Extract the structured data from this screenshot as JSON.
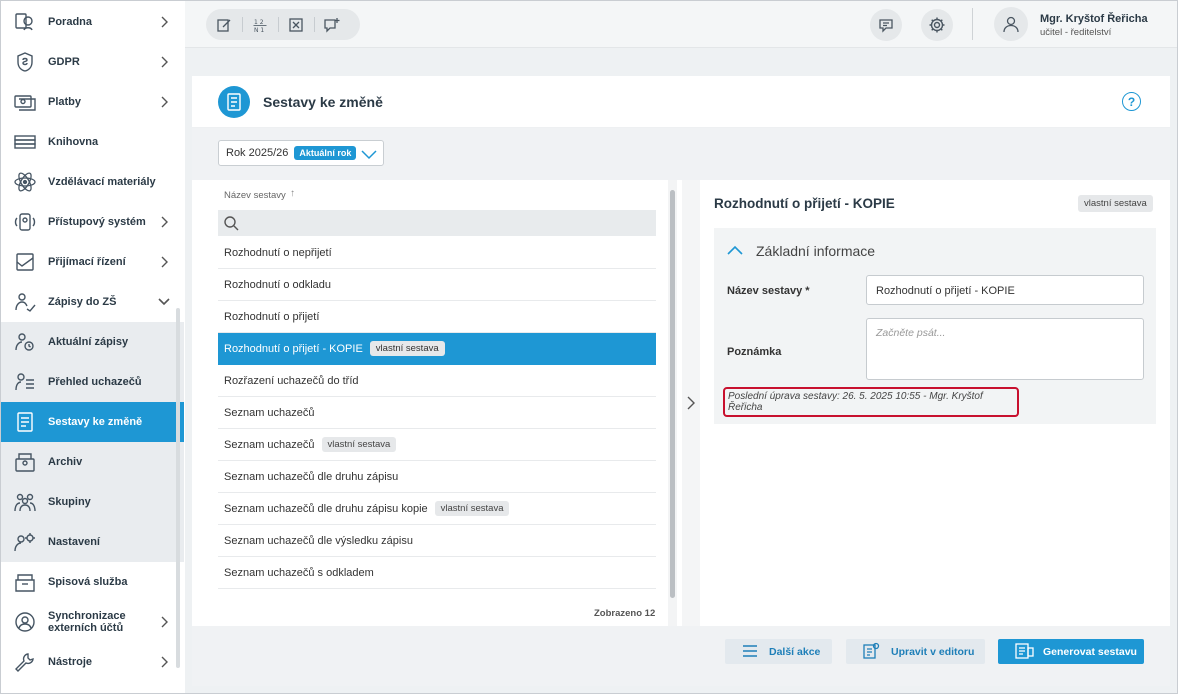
{
  "sidebar": {
    "items": [
      {
        "label": "Poradna",
        "icon": "consult-icon",
        "chevron": "right"
      },
      {
        "label": "GDPR",
        "icon": "gdpr-shield-icon",
        "chevron": "right"
      },
      {
        "label": "Platby",
        "icon": "payments-icon",
        "chevron": "right"
      },
      {
        "label": "Knihovna",
        "icon": "library-icon",
        "chevron": ""
      },
      {
        "label": "Vzdělávací materiály",
        "icon": "atom-icon",
        "chevron": ""
      },
      {
        "label": "Přístupový systém",
        "icon": "access-icon",
        "chevron": "right"
      },
      {
        "label": "Přijímací řízení",
        "icon": "admission-icon",
        "chevron": "right"
      },
      {
        "label": "Zápisy do ZŠ",
        "icon": "enrollment-icon",
        "chevron": "down"
      },
      {
        "label": "Aktuální zápisy",
        "icon": "current-enrollment-icon",
        "chevron": ""
      },
      {
        "label": "Přehled uchazečů",
        "icon": "applicants-icon",
        "chevron": ""
      },
      {
        "label": "Sestavy ke změně",
        "icon": "report-icon",
        "chevron": ""
      },
      {
        "label": "Archiv",
        "icon": "archive-icon",
        "chevron": ""
      },
      {
        "label": "Skupiny",
        "icon": "groups-icon",
        "chevron": ""
      },
      {
        "label": "Nastavení",
        "icon": "settings-user-icon",
        "chevron": ""
      },
      {
        "label": "Spisová služba",
        "icon": "filing-icon",
        "chevron": ""
      },
      {
        "label": "Synchronizace externích účtů",
        "icon": "sync-accounts-icon",
        "chevron": "right"
      },
      {
        "label": "Nástroje",
        "icon": "wrench-icon",
        "chevron": "right"
      }
    ]
  },
  "topbar": {
    "user_name": "Mgr. Kryštof Řeřicha",
    "user_role": "učitel - ředitelství",
    "tools": [
      "edit-icon",
      "numbering-icon",
      "close-box-icon",
      "add-comment-icon"
    ]
  },
  "page": {
    "title": "Sestavy ke změně",
    "help_label": "?"
  },
  "year_select": {
    "value": "Rok 2025/26",
    "badge": "Aktuální rok"
  },
  "list": {
    "column_header": "Název sestavy",
    "search_placeholder": "",
    "count_label": "Zobrazeno 12",
    "rows": [
      {
        "name": "Rozhodnutí o nepřijetí",
        "tag": ""
      },
      {
        "name": "Rozhodnutí o odkladu",
        "tag": ""
      },
      {
        "name": "Rozhodnutí o přijetí",
        "tag": ""
      },
      {
        "name": "Rozhodnutí o přijetí - KOPIE",
        "tag": "vlastní sestava"
      },
      {
        "name": "Rozřazení uchazečů do tříd",
        "tag": ""
      },
      {
        "name": "Seznam uchazečů",
        "tag": ""
      },
      {
        "name": "Seznam uchazečů",
        "tag": "vlastní sestava"
      },
      {
        "name": "Seznam uchazečů dle druhu zápisu",
        "tag": ""
      },
      {
        "name": "Seznam uchazečů dle druhu zápisu kopie",
        "tag": "vlastní sestava"
      },
      {
        "name": "Seznam uchazečů dle výsledku zápisu",
        "tag": ""
      },
      {
        "name": "Seznam uchazečů s odkladem",
        "tag": ""
      }
    ]
  },
  "detail": {
    "title": "Rozhodnutí o přijetí - KOPIE",
    "tag": "vlastní sestava",
    "section_title": "Základní informace",
    "name_label": "Název sestavy *",
    "name_value": "Rozhodnutí o přijetí - KOPIE",
    "note_label": "Poznámka",
    "note_placeholder": "Začněte psát...",
    "last_modified": "Poslední úprava sestavy: 26. 5. 2025 10:55 - Mgr. Kryštof Řeřicha"
  },
  "actions": {
    "more_label": "Další akce",
    "edit_label": "Upravit v editoru",
    "generate_label": "Generovat sestavu"
  },
  "colors": {
    "accent": "#1e97d4",
    "highlight_border": "#c8102e"
  }
}
